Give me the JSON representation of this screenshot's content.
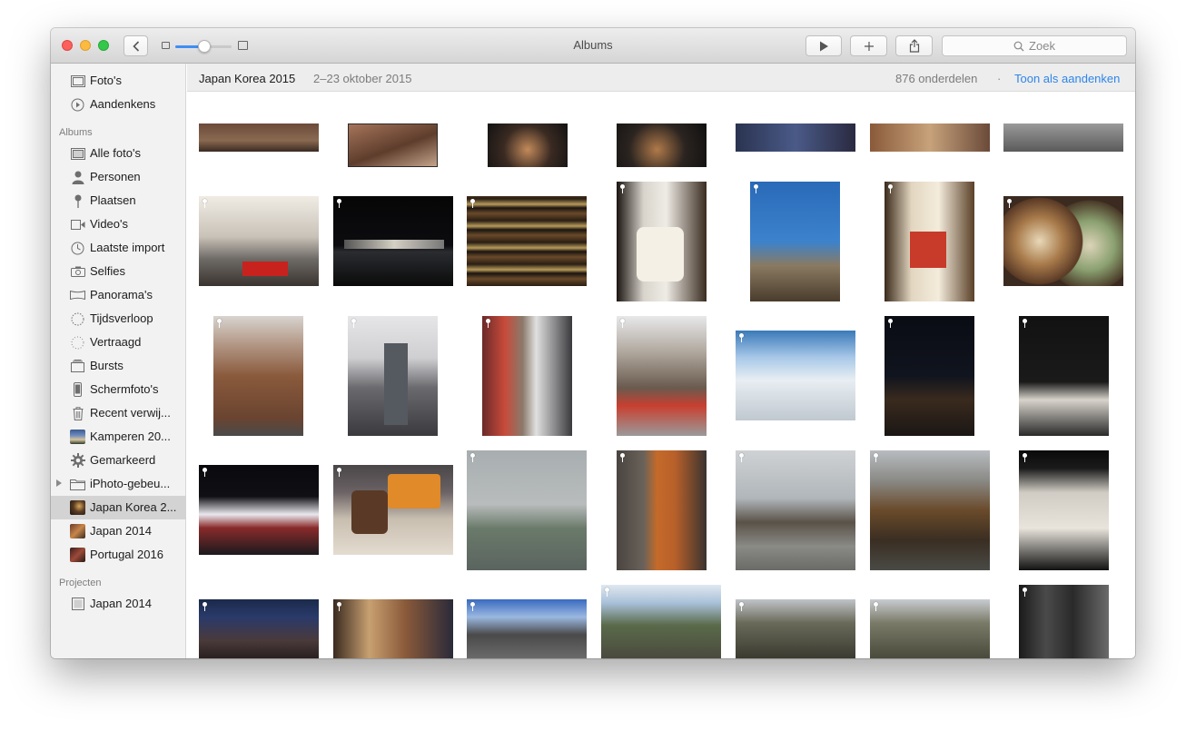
{
  "window": {
    "title": "Albums"
  },
  "toolbar": {
    "back_icon": "chevron-left-icon",
    "play_icon": "play-icon",
    "add_icon": "plus-icon",
    "share_icon": "share-icon",
    "search_placeholder": "Zoek",
    "zoom_level": 0.5
  },
  "sidebar": {
    "top_items": [
      {
        "label": "Foto's",
        "icon": "photos-icon"
      },
      {
        "label": "Aandenkens",
        "icon": "memories-icon"
      }
    ],
    "albums_heading": "Albums",
    "albums": [
      {
        "label": "Alle foto's",
        "icon": "all-photos-icon"
      },
      {
        "label": "Personen",
        "icon": "person-icon"
      },
      {
        "label": "Plaatsen",
        "icon": "pin-icon"
      },
      {
        "label": "Video's",
        "icon": "video-icon"
      },
      {
        "label": "Laatste import",
        "icon": "clock-icon"
      },
      {
        "label": "Selfies",
        "icon": "camera-icon"
      },
      {
        "label": "Panorama's",
        "icon": "panorama-icon"
      },
      {
        "label": "Tijdsverloop",
        "icon": "timelapse-icon"
      },
      {
        "label": "Vertraagd",
        "icon": "slomo-icon"
      },
      {
        "label": "Bursts",
        "icon": "burst-icon"
      },
      {
        "label": "Schermfoto's",
        "icon": "phone-icon"
      },
      {
        "label": "Recent verwij...",
        "icon": "trash-icon"
      },
      {
        "label": "Kamperen 20...",
        "icon": "album-thumb-icon"
      },
      {
        "label": "Gemarkeerd",
        "icon": "gear-icon"
      },
      {
        "label": "iPhoto-gebeu...",
        "icon": "folder-icon"
      },
      {
        "label": "Japan Korea 2...",
        "icon": "album-thumb-icon",
        "selected": true
      },
      {
        "label": "Japan 2014",
        "icon": "album-thumb-icon"
      },
      {
        "label": "Portugal 2016",
        "icon": "album-thumb-icon"
      }
    ],
    "projects_heading": "Projecten",
    "projects": [
      {
        "label": "Japan 2014",
        "icon": "book-icon"
      }
    ]
  },
  "album": {
    "title": "Japan Korea 2015",
    "date_range": "2–23 oktober 2015",
    "count": "876 onderdelen",
    "separator": "·",
    "memories_link": "Toon als aandenken"
  }
}
